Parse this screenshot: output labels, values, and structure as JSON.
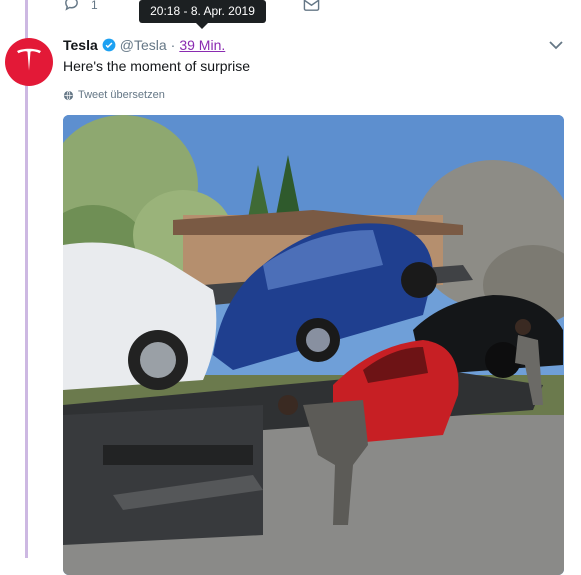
{
  "actions": {
    "reply_count": "1"
  },
  "tooltip": {
    "text": "20:18 - 8. Apr. 2019"
  },
  "tweet": {
    "author_name": "Tesla",
    "handle": "@Tesla",
    "separator": "·",
    "time_ago": "39 Min.",
    "text": "Here's the moment of surprise",
    "translate_label": "Tweet übersetzen"
  },
  "colors": {
    "thread_line": "#cdb8e2",
    "brand_red": "#e31937",
    "link_purple": "#8a2bb1",
    "verified_blue": "#1da1f2",
    "muted": "#657786"
  },
  "icons": {
    "reply": "speech-bubble-icon",
    "direct_message": "envelope-icon",
    "verified": "verified-badge-icon",
    "more": "chevron-down-icon",
    "translate": "globe-icon"
  }
}
